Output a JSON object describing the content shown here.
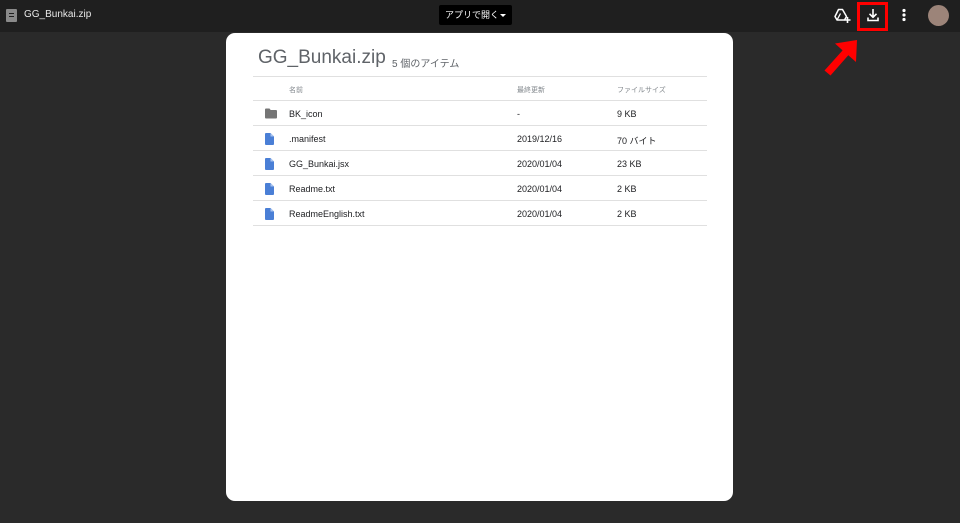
{
  "topbar": {
    "file_title": "GG_Bunkai.zip",
    "open_with_label": "アプリで開く"
  },
  "archive": {
    "title": "GG_Bunkai.zip",
    "item_count": "5 個のアイテム"
  },
  "table": {
    "headers": {
      "name": "名前",
      "modified": "最終更新",
      "size": "ファイルサイズ"
    },
    "rows": [
      {
        "icon": "folder-icon",
        "name": "BK_icon",
        "modified": "-",
        "size": "9 KB"
      },
      {
        "icon": "document-icon",
        "name": ".manifest",
        "modified": "2019/12/16",
        "size": "70 バイト"
      },
      {
        "icon": "document-icon",
        "name": "GG_Bunkai.jsx",
        "modified": "2020/01/04",
        "size": "23 KB"
      },
      {
        "icon": "document-icon",
        "name": "Readme.txt",
        "modified": "2020/01/04",
        "size": "2 KB"
      },
      {
        "icon": "document-icon",
        "name": "ReadmeEnglish.txt",
        "modified": "2020/01/04",
        "size": "2 KB"
      }
    ]
  },
  "colors": {
    "background": "#2a2a2a",
    "topbar": "#1f1f1f",
    "highlight": "#ff0000",
    "document_icon": "#4a7fd6",
    "folder_icon": "#757575"
  }
}
